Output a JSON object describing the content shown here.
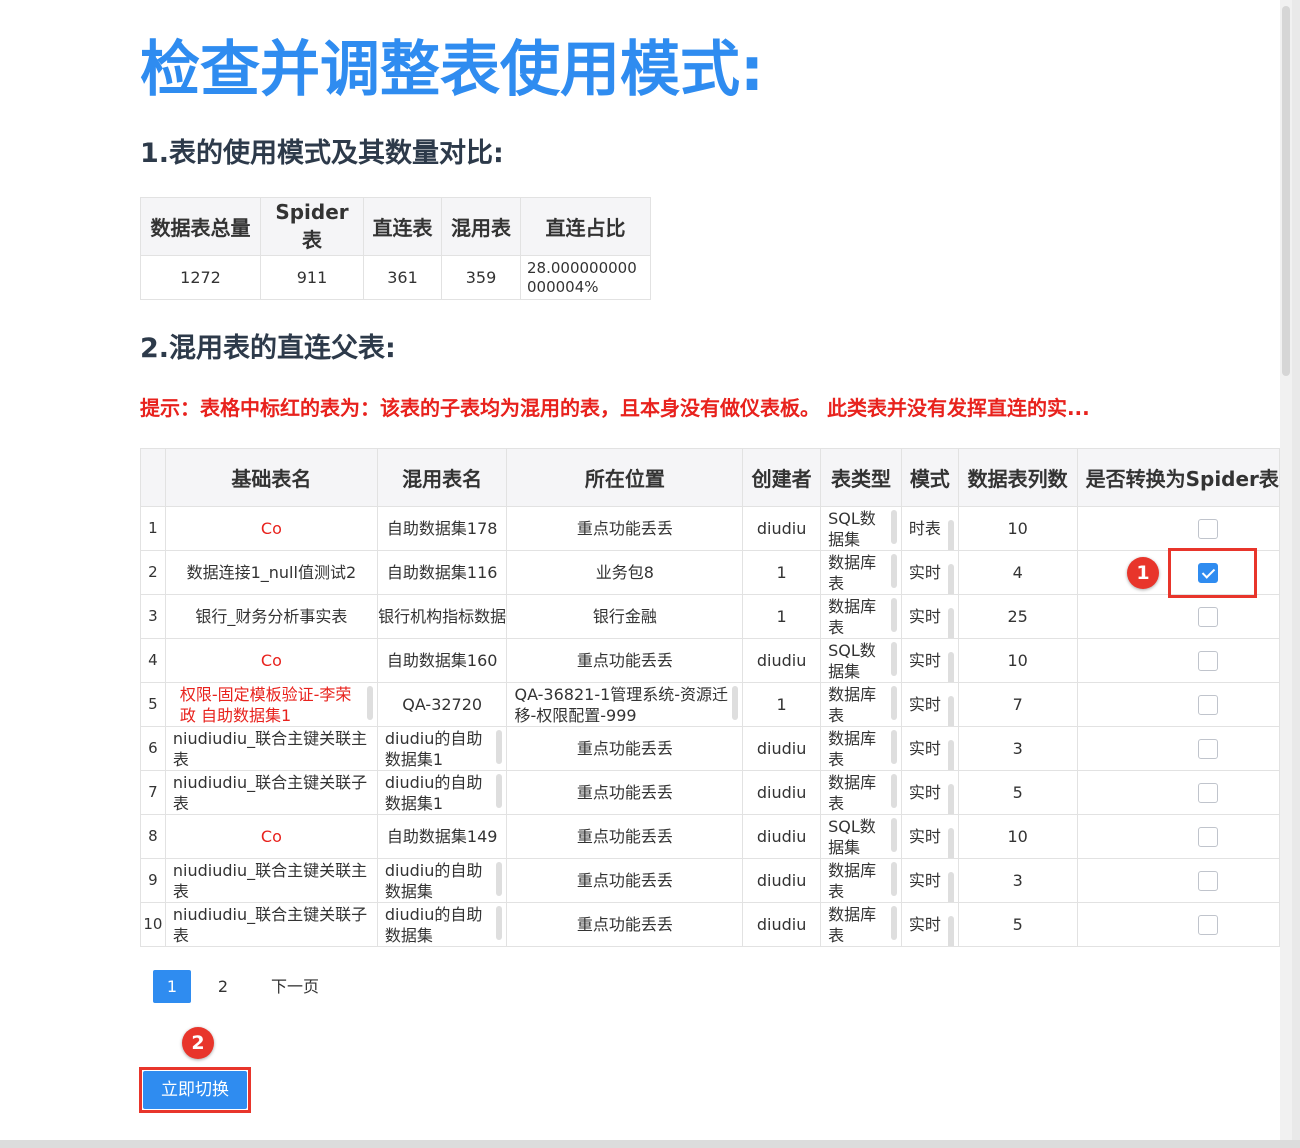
{
  "title": "检查并调整表使用模式:",
  "section1_title": "1.表的使用模式及其数量对比:",
  "stats": {
    "headers": [
      "数据表总量",
      "Spider表",
      "直连表",
      "混用表",
      "直连占比"
    ],
    "values": [
      "1272",
      "911",
      "361",
      "359",
      "28.000000000000004%"
    ]
  },
  "section2_title": "2.混用表的直连父表:",
  "hint": "提示：表格中标红的表为：该表的子表均为混用的表，且本身没有做仪表板。 此类表并没有发挥直连的实...",
  "table": {
    "headers": [
      "",
      "基础表名",
      "混用表名",
      "所在位置",
      "创建者",
      "表类型",
      "模式",
      "数据表列数",
      "是否转换为Spider表"
    ],
    "rows": [
      {
        "idx": "1",
        "base": "Co",
        "mixed": "自助数据集178",
        "location": "重点功能丢丢",
        "creator": "diudiu",
        "type": "SQL数据集",
        "mode": "时表",
        "cols": "10",
        "checked": false
      },
      {
        "idx": "2",
        "base": "数据连接1_null值测试2",
        "mixed": "自助数据集116",
        "location": "业务包8",
        "creator": "1",
        "type": "数据库表",
        "mode": "实时",
        "cols": "4",
        "checked": true
      },
      {
        "idx": "3",
        "base": "银行_财务分析事实表",
        "mixed": "银行机构指标数据",
        "location": "银行金融",
        "creator": "1",
        "type": "数据库表",
        "mode": "实时",
        "cols": "25",
        "checked": false
      },
      {
        "idx": "4",
        "base": "Co",
        "mixed": "自助数据集160",
        "location": "重点功能丢丢",
        "creator": "diudiu",
        "type": "SQL数据集",
        "mode": "实时",
        "cols": "10",
        "checked": false
      },
      {
        "idx": "5",
        "base": "权限-固定模板验证-李荣政 自助数据集1",
        "mixed": "QA-32720",
        "location": "QA-36821-1管理系统-资源迁移-权限配置-999",
        "creator": "1",
        "type": "数据库表",
        "mode": "实时",
        "cols": "7",
        "checked": false
      },
      {
        "idx": "6",
        "base": "niudiudiu_联合主键关联主表",
        "mixed": "diudiu的自助数据集1",
        "location": "重点功能丢丢",
        "creator": "diudiu",
        "type": "数据库表",
        "mode": "实时",
        "cols": "3",
        "checked": false
      },
      {
        "idx": "7",
        "base": "niudiudiu_联合主键关联子表",
        "mixed": "diudiu的自助数据集1",
        "location": "重点功能丢丢",
        "creator": "diudiu",
        "type": "数据库表",
        "mode": "实时",
        "cols": "5",
        "checked": false
      },
      {
        "idx": "8",
        "base": "Co",
        "mixed": "自助数据集149",
        "location": "重点功能丢丢",
        "creator": "diudiu",
        "type": "SQL数据集",
        "mode": "实时",
        "cols": "10",
        "checked": false
      },
      {
        "idx": "9",
        "base": "niudiudiu_联合主键关联主表",
        "mixed": "diudiu的自助数据集",
        "location": "重点功能丢丢",
        "creator": "diudiu",
        "type": "数据库表",
        "mode": "实时",
        "cols": "3",
        "checked": false
      },
      {
        "idx": "10",
        "base": "niudiudiu_联合主键关联子表",
        "mixed": "diudiu的自助数据集",
        "location": "重点功能丢丢",
        "creator": "diudiu",
        "type": "数据库表",
        "mode": "实时",
        "cols": "5",
        "checked": false
      }
    ]
  },
  "pagination": {
    "pages": [
      "1",
      "2"
    ],
    "current": "1",
    "next_label": "下一页"
  },
  "switch_button": "立即切换",
  "annotations": {
    "badge1": "1",
    "badge2": "2"
  },
  "colors": {
    "accent": "#2f8cf0",
    "warning": "#e8221d",
    "annotation": "#e8352b"
  }
}
